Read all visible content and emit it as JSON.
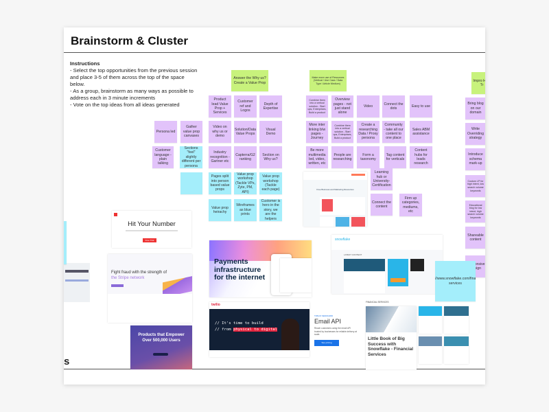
{
  "board": {
    "title": "Brainstorm & Cluster",
    "instructions": {
      "heading": "Instructions",
      "lines": [
        "- Select the top opportunities from the previous session and place 3-5 of them across the top of the space below.",
        "- As a group, brainstorm as many ways as possible to address each in 3 minute increments",
        "- Vote on the top ideas from all ideas generated"
      ]
    },
    "left_edge_text": "s"
  },
  "colors": {
    "purple": "#e2c3fa",
    "green": "#c8f27c",
    "cyan": "#a4eefb"
  },
  "stickies": [
    {
      "text": "Answer the Why us? Create a Value Prop",
      "color": "green"
    },
    {
      "text": "Product lead Value Prop + Services",
      "color": "purple"
    },
    {
      "text": "Customer ref and Logos",
      "color": "purple"
    },
    {
      "text": "Depth of Expertise",
      "color": "purple"
    },
    {
      "text": "Persona led",
      "color": "purple"
    },
    {
      "text": "Gather value prop canvases",
      "color": "purple"
    },
    {
      "text": "Video on why us or demo",
      "color": "purple"
    },
    {
      "text": "Solution/Data Value Props",
      "color": "purple"
    },
    {
      "text": "Visual Demo",
      "color": "purple"
    },
    {
      "text": "Customer language - plain talking",
      "color": "purple"
    },
    {
      "text": "Sections \"feel\" slightly different per persona",
      "color": "cyan"
    },
    {
      "text": "Industry recognition - Gartner etc",
      "color": "purple"
    },
    {
      "text": "Capterra/G2 ranking",
      "color": "purple"
    },
    {
      "text": "Section on Why us?",
      "color": "purple"
    },
    {
      "text": "",
      "color": "cyan"
    },
    {
      "text": "Pages split into person based value props",
      "color": "cyan"
    },
    {
      "text": "Value prop workshop (Tackle VPs, Zyte, PM, API)",
      "color": "cyan"
    },
    {
      "text": "Value prop workshop (Tackle each page)",
      "color": "cyan"
    },
    {
      "text": "Value prop heirachy",
      "color": "cyan"
    },
    {
      "text": "Wireframes as blue prints",
      "color": "cyan"
    },
    {
      "text": "Customer is hero in the story, we are the helpers",
      "color": "cyan"
    },
    {
      "text": "Make more use of Resources (Vertical / Use Case / Data Type / Article Medium)",
      "color": "green"
    },
    {
      "text": "Combine them into a vertical solution - Start ups, Enterprises, Build a product",
      "color": "purple"
    },
    {
      "text": "Overview pages - not just stand alone",
      "color": "purple"
    },
    {
      "text": "Video",
      "color": "purple"
    },
    {
      "text": "Connect the dots",
      "color": "purple"
    },
    {
      "text": "Easy to use",
      "color": "purple"
    },
    {
      "text": "More inter linking b/w pages - Journey",
      "color": "purple"
    },
    {
      "text": "Combine them into a vertical solution - Start ups, Enterprises, Build a product",
      "color": "purple"
    },
    {
      "text": "Create a researching Data / Proxy persona",
      "color": "purple"
    },
    {
      "text": "Community - take all our content to one place",
      "color": "purple"
    },
    {
      "text": "Sales ABM assistance",
      "color": "purple"
    },
    {
      "text": "Be more multimedia led, video, written, etc",
      "color": "purple"
    },
    {
      "text": "People are researching",
      "color": "purple"
    },
    {
      "text": "Form a taxonomy",
      "color": "purple"
    },
    {
      "text": "Tag content for verticals",
      "color": "purple"
    },
    {
      "text": "Content hubs for leads research",
      "color": "purple"
    },
    {
      "text": "Learning hub or University- Certification",
      "color": "purple"
    },
    {
      "text": "Connect the content",
      "color": "purple"
    },
    {
      "text": "Firm up categories, mediums, etc",
      "color": "purple"
    },
    {
      "text": "Impro High Tr",
      "color": "green"
    },
    {
      "text": "Bring blog on our domain",
      "color": "purple"
    },
    {
      "text": "Write Overriding strategy",
      "color": "purple"
    },
    {
      "text": "Introduce schema mark-up",
      "color": "purple"
    },
    {
      "text": "Custom LP for high intent, low search volume keywords",
      "color": "purple"
    },
    {
      "text": "Educational blog for low intent, high search volume keywords",
      "color": "purple"
    },
    {
      "text": "Shareable content",
      "color": "purple"
    },
    {
      "text": "Responsive Design",
      "color": "purple"
    },
    {
      "text": "https://www.snowflake.com/financial-services",
      "color": "cyan"
    },
    {
      "text": "",
      "color": "cyan"
    }
  ],
  "screenshots": {
    "hit": {
      "title": "Hit Your Number",
      "cta": "Free Trial"
    },
    "fraud": {
      "title": "Fight fraud with the strength of",
      "accent": "the Stripe network"
    },
    "empower": {
      "title": "Products that Empower Over 500,000 Users"
    },
    "payments": {
      "title": "Payments infrastructure for the internet"
    },
    "twilio": {
      "brand": "twilio",
      "line1": "// It's time to build",
      "line2a": "// from ",
      "line2b": "physical to digital"
    },
    "email": {
      "eyebrow": "TWILIO SENDGRID",
      "title": "Email API",
      "body": "Reach customers using the email API trusted by businesses for reliable delivery at scale.",
      "cta": "See pricing"
    },
    "snowflake": {
      "brand": "snowflake",
      "section": "LATEST CONTENT"
    },
    "finserv": {
      "section": "FINANCIAL SERVICES",
      "title": "Little Book of Big Success with Snowflake - Financial Services"
    },
    "hubspot": {
      "title": "Free Business and Marketing Resources"
    }
  }
}
